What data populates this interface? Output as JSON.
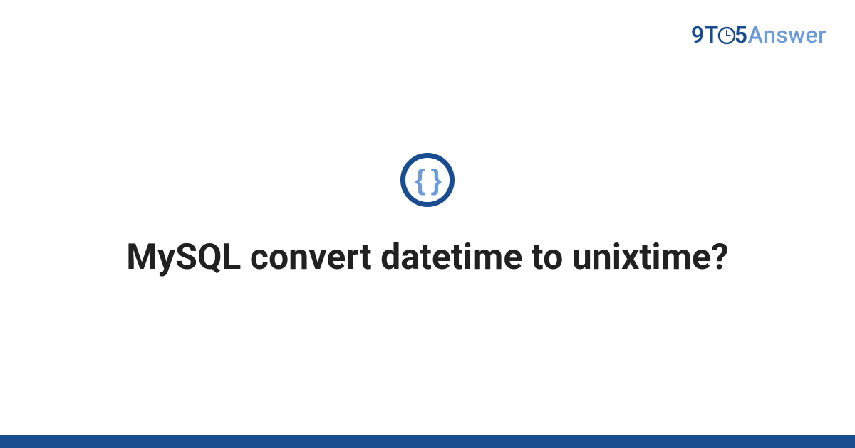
{
  "brand": {
    "part1": "9T",
    "part2": "5",
    "part3": "Answer"
  },
  "badge": {
    "symbol": "{ }"
  },
  "question": {
    "title": "MySQL convert datetime to unixtime?"
  },
  "colors": {
    "primary": "#1a4d8f",
    "secondary": "#6b9bd8"
  }
}
